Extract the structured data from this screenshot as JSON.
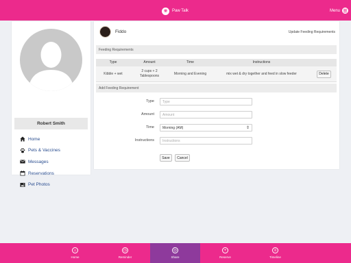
{
  "header": {
    "brand": "Paw Talk",
    "menu_label": "Menu"
  },
  "sidebar": {
    "user_name": "Robert Smith",
    "items": [
      {
        "label": "Home",
        "icon": "home-icon"
      },
      {
        "label": "Pets & Vaccines",
        "icon": "paw-icon"
      },
      {
        "label": "Messages",
        "icon": "envelope-icon"
      },
      {
        "label": "Reservations",
        "icon": "calendar-icon"
      },
      {
        "label": "Pet Photos",
        "icon": "image-icon"
      }
    ]
  },
  "main": {
    "pet_name": "Fiddo",
    "update_link": "Update Feeding Requirements",
    "feeding_section_title": "Feeding Requirements",
    "table": {
      "headers": [
        "Type",
        "Amount",
        "Time",
        "Instructions"
      ],
      "rows": [
        {
          "type": "Kibble + wet",
          "amount_line1": "2 cups + 2",
          "amount_line2": "Tablespoons",
          "time": "Morning and Evening",
          "instructions": "mix wet & dry together and feed in slow feeder",
          "action": "Delete"
        }
      ]
    },
    "add_section_title": "Add Feeding Requirement",
    "form": {
      "type_label": "Type",
      "type_placeholder": "Type",
      "amount_label": "Amount",
      "amount_placeholder": "Amount",
      "time_label": "Time",
      "time_value": "Morning (AM)",
      "instructions_label": "Instructions",
      "instructions_placeholder": "Instructions",
      "save_label": "Save",
      "cancel_label": "Cancel"
    }
  },
  "bottom_nav": [
    {
      "label": "Home",
      "icon": "home-circle-icon",
      "active": false
    },
    {
      "label": "Reminder",
      "icon": "reminder-icon",
      "active": false
    },
    {
      "label": "Share",
      "icon": "share-icon",
      "active": true
    },
    {
      "label": "Reserve",
      "icon": "plus-icon",
      "active": false
    },
    {
      "label": "Timeline",
      "icon": "timeline-icon",
      "active": false
    }
  ],
  "colors": {
    "brand": "#ec2a8c",
    "active_tab": "#8e3a9c",
    "link": "#2a4d8f"
  }
}
